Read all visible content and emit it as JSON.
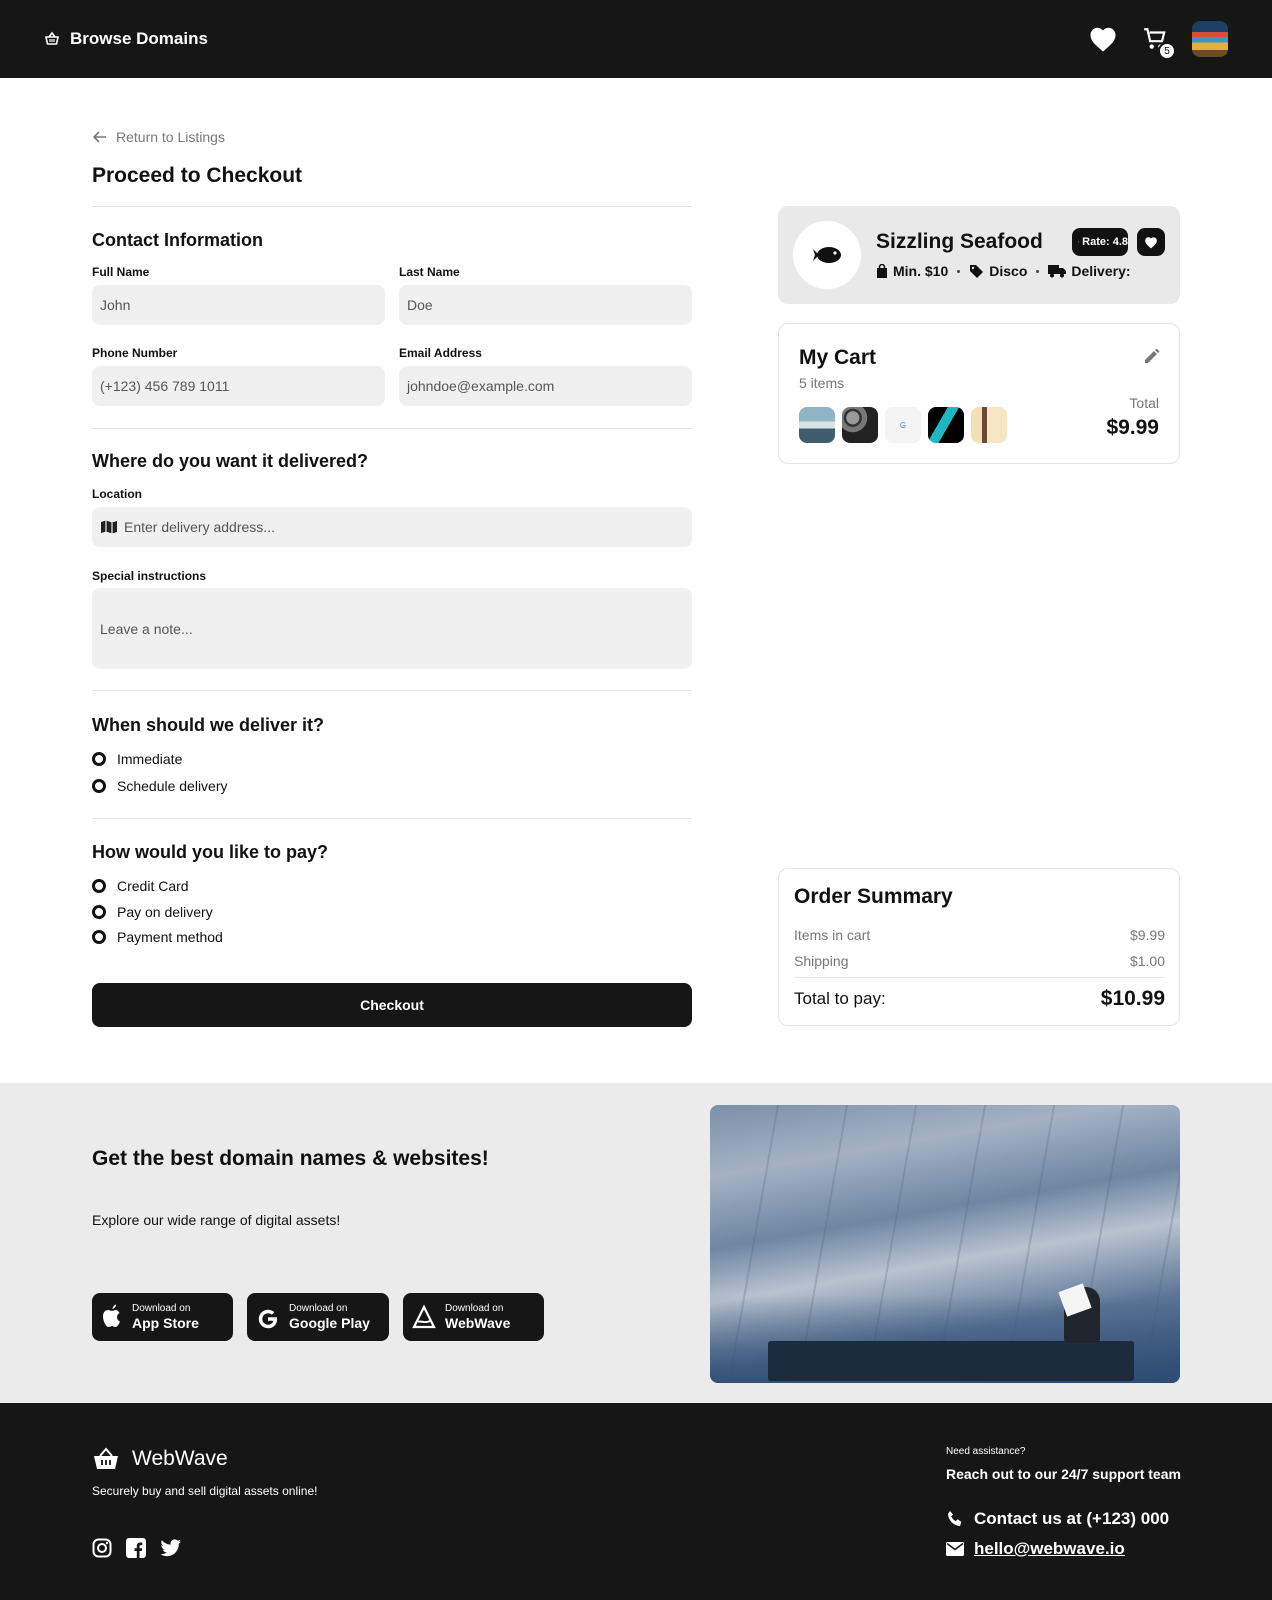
{
  "header": {
    "brand": "Browse Domains",
    "cart_count": "5"
  },
  "back_link": "Return to Listings",
  "page_title": "Proceed to Checkout",
  "contact": {
    "title": "Contact Information",
    "full_name_label": "Full Name",
    "full_name_value": "John",
    "last_name_label": "Last Name",
    "last_name_value": "Doe",
    "phone_label": "Phone Number",
    "phone_value": "(+123) 456 789 1011",
    "email_label": "Email Address",
    "email_value": "johndoe@example.com"
  },
  "delivery": {
    "title": "Where do you want it delivered?",
    "location_label": "Location",
    "location_placeholder": "Enter delivery address...",
    "instructions_label": "Special instructions",
    "instructions_placeholder": "Leave a note..."
  },
  "timing": {
    "title": "When should we deliver it?",
    "options": [
      "Immediate",
      "Schedule delivery"
    ]
  },
  "payment": {
    "title": "How would you like to pay?",
    "options": [
      "Credit Card",
      "Pay on delivery",
      "Payment method"
    ]
  },
  "checkout_label": "Checkout",
  "restaurant": {
    "name": "Sizzling Seafood",
    "rate_label": "Rate: 4.8",
    "min": "Min. $10",
    "discount": "Disco",
    "delivery": "Delivery:"
  },
  "cart": {
    "title": "My Cart",
    "count": "5 items",
    "total_label": "Total",
    "total_value": "$9.99",
    "thumbnails": [
      "harbor-photo",
      "pebbles-photo",
      "google-logo",
      "teal-logo",
      "drinks-photo"
    ]
  },
  "summary": {
    "title": "Order Summary",
    "rows": [
      {
        "label": "Items in cart",
        "value": "$9.99"
      },
      {
        "label": "Shipping",
        "value": "$1.00"
      }
    ],
    "total_label": "Total to pay:",
    "total_value": "$10.99"
  },
  "promo": {
    "title": "Get the best domain names & websites!",
    "subtitle": "Explore our wide range of digital assets!",
    "stores": [
      {
        "small": "Download on",
        "big": "App Store",
        "icon": "apple-icon"
      },
      {
        "small": "Download on",
        "big": "Google Play",
        "icon": "google-icon"
      },
      {
        "small": "Download on",
        "big": "WebWave",
        "icon": "webwave-icon"
      }
    ]
  },
  "footer": {
    "brand": "WebWave",
    "tagline": "Securely buy and sell digital assets online!",
    "help": "Need assistance?",
    "team": "Reach out to our 24/7 support team",
    "contact": "Contact us at (+123) 000",
    "email": "hello@webwave.io"
  },
  "colors": {
    "dark": "#161616",
    "input_bg": "#f0f0f0",
    "card_bg": "#e9e9e9",
    "promo_bg": "#ebebeb"
  }
}
